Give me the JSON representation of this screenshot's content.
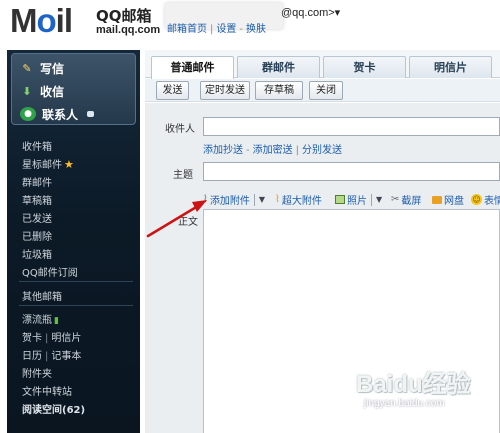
{
  "header": {
    "logo_left": "M",
    "logo_o": "o",
    "logo_right": "il",
    "product": "QQ邮箱",
    "domain": "mail.qq.com",
    "account_suffix": "@qq.com>▾",
    "links": [
      "邮箱首页",
      "设置",
      "换肤"
    ]
  },
  "sidebar": {
    "quick": [
      {
        "label": "写信",
        "icon": "pencil-icon"
      },
      {
        "label": "收信",
        "icon": "download-icon"
      },
      {
        "label": "联系人",
        "icon": "contacts-icon"
      }
    ],
    "folders": {
      "inbox": "收件箱",
      "starred": "星标邮件",
      "group": "群邮件",
      "drafts": "草稿箱",
      "sent": "已发送",
      "deleted": "已删除",
      "spam": "垃圾箱",
      "subscription": "QQ邮件订阅",
      "other": "其他邮箱",
      "drift_bottle": "漂流瓶",
      "card": "贺卡",
      "postcard": "明信片",
      "calendar": "日历",
      "notepad": "记事本",
      "attachments": "附件夹",
      "file_transfer": "文件中转站",
      "reading": "阅读空间(62)"
    }
  },
  "tabs": [
    "普通邮件",
    "群邮件",
    "贺卡",
    "明信片"
  ],
  "toolbar": {
    "send": "发送",
    "schedule": "定时发送",
    "draft": "存草稿",
    "close": "关闭"
  },
  "form": {
    "recipient_label": "收件人",
    "recipient_value": "",
    "recipient_links": [
      "添加抄送",
      "添加密送",
      "分别发送"
    ],
    "subject_label": "主题",
    "subject_value": "",
    "body_label": "正文"
  },
  "attach": {
    "add": "添加附件",
    "large": "超大附件",
    "photo": "照片",
    "screenshot": "截屏",
    "disk": "网盘",
    "emoji": "表情"
  },
  "watermark": {
    "logo": "Baidu经验",
    "url": "jingyan.baidu.com"
  },
  "colors": {
    "sidebar": "#0c1a27",
    "link": "#1e5dab",
    "arrow": "#cc1414",
    "form_bg": "#eaeef1"
  }
}
